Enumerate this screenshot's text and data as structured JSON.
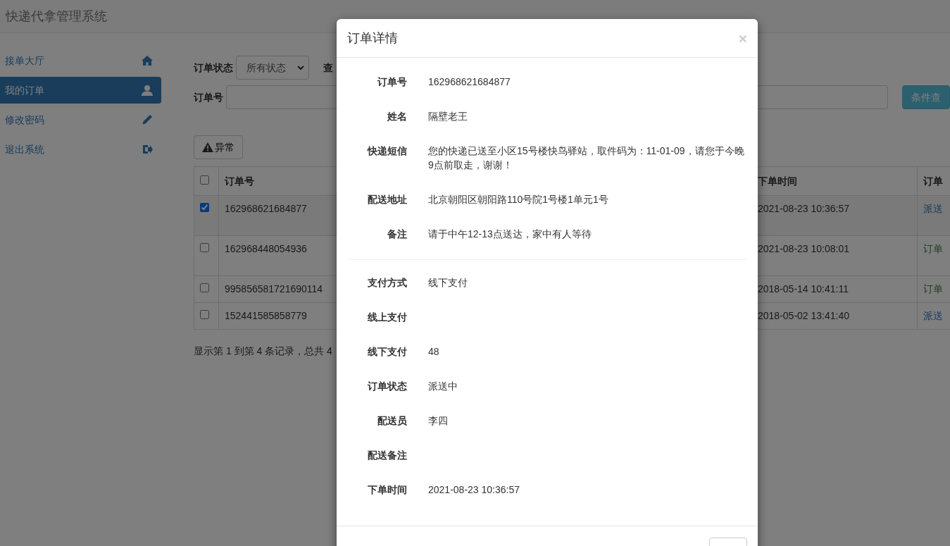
{
  "app_title": "快递代拿管理系统",
  "sidebar": {
    "items": [
      {
        "label": "接单大厅",
        "selected": false
      },
      {
        "label": "我的订单",
        "selected": true
      },
      {
        "label": "修改密码",
        "selected": false
      },
      {
        "label": "退出系统",
        "selected": false
      }
    ]
  },
  "filters": {
    "status_label": "订单状态",
    "status_value": "所有状态",
    "query_label": "查",
    "order_label": "订单号",
    "search_button": "条件查"
  },
  "toolbar": {
    "exception_button": "异常"
  },
  "table": {
    "header_checked": false,
    "columns": [
      "订单号",
      "下单时间",
      "订单"
    ],
    "rows": [
      {
        "selected": true,
        "order_no": "162968621684877",
        "time": "2021-08-23 10:36:57",
        "status": "派送",
        "kind": "delivering"
      },
      {
        "selected": false,
        "order_no": "162968448054936",
        "time": "2021-08-23 10:08:01",
        "status": "订单",
        "kind": "done"
      },
      {
        "selected": false,
        "order_no": "995856581721690114",
        "time": "2018-05-14 10:41:11",
        "status": "订单",
        "kind": "done"
      },
      {
        "selected": false,
        "order_no": "152441585858779",
        "time": "2018-05-02 13:41:40",
        "status": "派送",
        "kind": "delivering"
      }
    ]
  },
  "pagination_info": "显示第 1 到第 4 条记录，总共 4",
  "modal": {
    "title": "订单详情",
    "close": "×",
    "sections": [
      [
        {
          "label": "订单号",
          "value": "162968621684877"
        },
        {
          "label": "姓名",
          "value": "隔壁老王"
        },
        {
          "label": "快递短信",
          "value": "您的快递已送至小区15号楼快鸟驿站，取件码为：11-01-09，请您于今晚9点前取走，谢谢！"
        },
        {
          "label": "配送地址",
          "value": "北京朝阳区朝阳路110号院1号楼1单元1号"
        },
        {
          "label": "备注",
          "value": "请于中午12-13点送达，家中有人等待"
        }
      ],
      [
        {
          "label": "支付方式",
          "value": "线下支付"
        },
        {
          "label": "线上支付"
        },
        {
          "label": "线下支付",
          "value": "48"
        },
        {
          "label": "订单状态",
          "value": "派送中"
        },
        {
          "label": "配送员",
          "value": "李四"
        },
        {
          "label": "配送备注"
        },
        {
          "label": "下单时间",
          "value": "2021-08-23 10:36:57"
        }
      ]
    ]
  }
}
